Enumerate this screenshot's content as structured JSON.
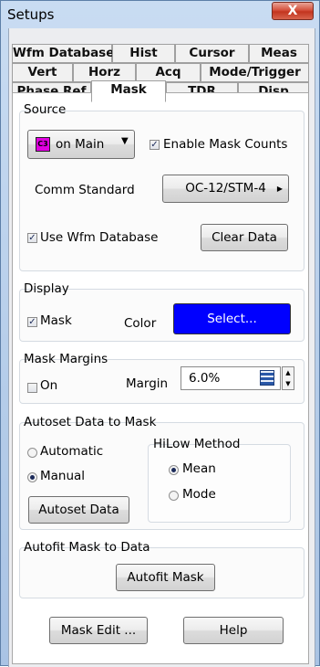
{
  "window": {
    "title": "Setups",
    "close_label": "X"
  },
  "tabs": {
    "row1": [
      "Wfm Database",
      "Hist",
      "Cursor",
      "Meas"
    ],
    "row2": [
      "Vert",
      "Horz",
      "Acq",
      "Mode/Trigger"
    ],
    "row3": [
      "Phase Ref",
      "Mask",
      "TDR",
      "Disp"
    ],
    "active": "Mask"
  },
  "source": {
    "group_label": "Source",
    "channel_badge": "C3",
    "channel_badge_color": "#e000e0",
    "selected_value": "on Main",
    "enable_mask_counts_label": "Enable Mask Counts",
    "enable_mask_counts_checked": true,
    "comm_standard_label": "Comm Standard",
    "comm_standard_value": "OC-12/STM-4",
    "use_wfm_database_label": "Use Wfm Database",
    "use_wfm_database_checked": true,
    "clear_data_label": "Clear Data"
  },
  "display": {
    "group_label": "Display",
    "mask_label": "Mask",
    "mask_checked": true,
    "color_label": "Color",
    "select_button_label": "Select...",
    "select_button_color": "#0000ff"
  },
  "mask_margins": {
    "group_label": "Mask Margins",
    "on_label": "On",
    "on_checked": false,
    "margin_label": "Margin",
    "margin_value": "6.0%"
  },
  "autoset": {
    "group_label": "Autoset Data to Mask",
    "automatic_label": "Automatic",
    "manual_label": "Manual",
    "mode_selected": "Manual",
    "autoset_button_label": "Autoset Data",
    "hilow_label": "HiLow Method",
    "mean_label": "Mean",
    "mode_label": "Mode",
    "hilow_selected": "Mean"
  },
  "autofit": {
    "group_label": "Autofit Mask to Data",
    "button_label": "Autofit Mask"
  },
  "footer": {
    "mask_edit_label": "Mask Edit ...",
    "help_label": "Help"
  }
}
